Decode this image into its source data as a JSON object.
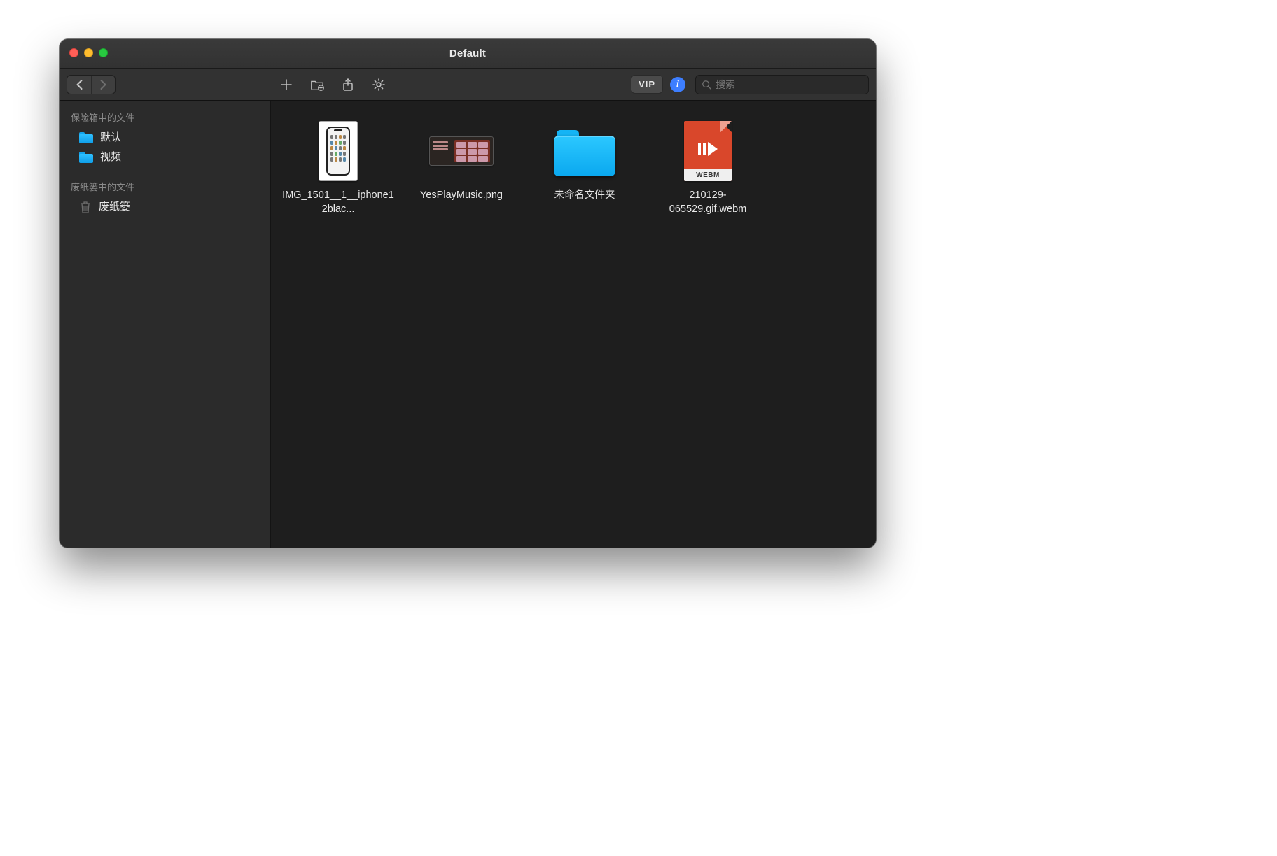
{
  "window": {
    "title": "Default"
  },
  "toolbar": {
    "vip_label": "VIP",
    "info_glyph": "i"
  },
  "search": {
    "placeholder": "搜索"
  },
  "sidebar": {
    "sections": [
      {
        "header": "保险箱中的文件",
        "items": [
          {
            "label": "默认",
            "icon": "folder"
          },
          {
            "label": "视频",
            "icon": "folder"
          }
        ]
      },
      {
        "header": "废纸篓中的文件",
        "items": [
          {
            "label": "废纸篓",
            "icon": "trash"
          }
        ]
      }
    ]
  },
  "files": [
    {
      "name": "IMG_1501__1__iphone12blac...",
      "kind": "image-phone"
    },
    {
      "name": "YesPlayMusic.png",
      "kind": "image-screenshot"
    },
    {
      "name": "未命名文件夹",
      "kind": "folder"
    },
    {
      "name": "210129-065529.gif.webm",
      "kind": "webm",
      "badge": "WEBM"
    }
  ]
}
